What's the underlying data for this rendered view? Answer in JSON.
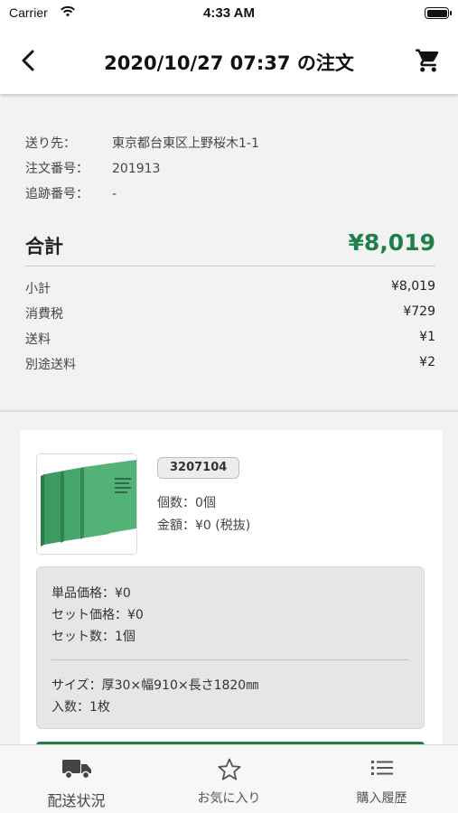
{
  "status_bar": {
    "carrier": "Carrier",
    "time": "4:33 AM"
  },
  "nav": {
    "title": "2020/10/27 07:37 の注文"
  },
  "shipping": {
    "rows": [
      {
        "label": "送り先：",
        "value": "東京都台東区上野桜木1-1"
      },
      {
        "label": "注文番号：",
        "value": "201913"
      },
      {
        "label": "追跡番号：",
        "value": "-"
      }
    ]
  },
  "totals": {
    "total_label": "合計",
    "total_value": "¥8,019",
    "rows": [
      {
        "label": "小計",
        "value": "¥8,019"
      },
      {
        "label": "消費税",
        "value": "¥729"
      },
      {
        "label": "送料",
        "value": "¥1"
      },
      {
        "label": "別途送料",
        "value": "¥2"
      }
    ]
  },
  "product": {
    "code": "3207104",
    "quantity": "個数：0個",
    "amount": "金額：¥0 (税抜)",
    "details": {
      "unit_price": "単品価格：¥0",
      "set_price": "セット価格：¥0",
      "set_count": "セット数：1個",
      "size": "サイズ：厚30×幅910×長さ1820㎜",
      "pieces": "入数：1枚"
    }
  },
  "tabs": [
    {
      "label": "配送状況",
      "icon": "truck-icon"
    },
    {
      "label": "お気に入り",
      "icon": "star-icon"
    },
    {
      "label": "購入履歴",
      "icon": "list-icon"
    }
  ],
  "colors": {
    "accent": "#1e8049",
    "background": "#f2f2f2",
    "card": "#ffffff",
    "detail_box": "#e6e6e6"
  }
}
